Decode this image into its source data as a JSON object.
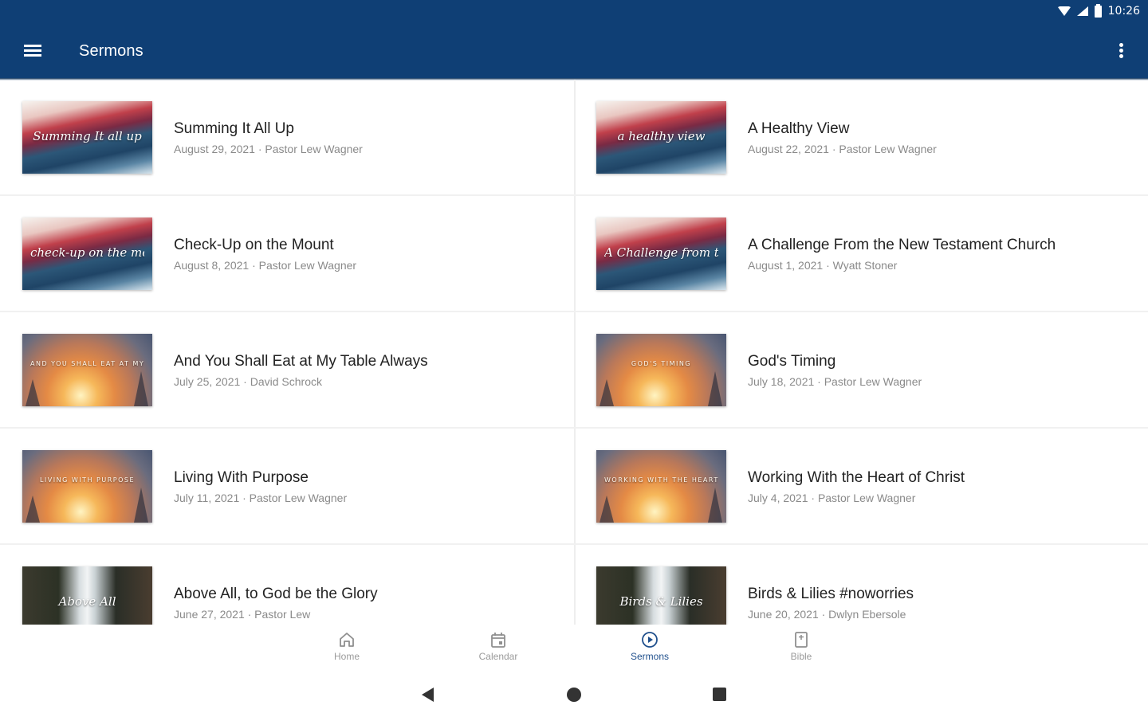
{
  "status_bar": {
    "time": "10:26"
  },
  "app_bar": {
    "title": "Sermons"
  },
  "sermons": [
    {
      "title": "Summing It All Up",
      "meta": "August 29, 2021 · Pastor Lew Wagner",
      "thumb_caption": "Summing It all up",
      "thumb_style": "wave"
    },
    {
      "title": "A Healthy View",
      "meta": "August 22, 2021 · Pastor Lew Wagner",
      "thumb_caption": "a healthy view",
      "thumb_style": "wave"
    },
    {
      "title": "Check-Up on the Mount",
      "meta": "August 8, 2021 · Pastor Lew Wagner",
      "thumb_caption": "check-up on the mount",
      "thumb_style": "wave"
    },
    {
      "title": "A Challenge From the New Testament Church",
      "meta": "August 1, 2021 · Wyatt Stoner",
      "thumb_caption": "A Challenge from the New Testament Church",
      "thumb_style": "wave"
    },
    {
      "title": "And You Shall Eat at My Table Always",
      "meta": "July 25, 2021 · David Schrock",
      "thumb_caption": "AND YOU SHALL EAT AT MY TABLE ALWAYS",
      "thumb_style": "sunrise"
    },
    {
      "title": "God's Timing",
      "meta": "July 18, 2021 · Pastor Lew Wagner",
      "thumb_caption": "GOD'S TIMING",
      "thumb_style": "sunrise"
    },
    {
      "title": "Living With Purpose",
      "meta": "July 11, 2021 · Pastor Lew Wagner",
      "thumb_caption": "LIVING WITH PURPOSE",
      "thumb_style": "sunrise"
    },
    {
      "title": "Working With the Heart of Christ",
      "meta": "July 4, 2021 · Pastor Lew Wagner",
      "thumb_caption": "WORKING WITH THE HEART OF CHRIST",
      "thumb_style": "sunrise"
    },
    {
      "title": "Above All, to God be the Glory",
      "meta": "June 27, 2021 · Pastor Lew",
      "thumb_caption": "Above All",
      "thumb_style": "falls"
    },
    {
      "title": "Birds & Lilies #noworries",
      "meta": "June 20, 2021 · Dwlyn Ebersole",
      "thumb_caption": "Birds & Lilies",
      "thumb_style": "falls"
    }
  ],
  "bottom_nav": [
    {
      "label": "Home",
      "icon": "home-icon",
      "active": false
    },
    {
      "label": "Calendar",
      "icon": "calendar-icon",
      "active": false
    },
    {
      "label": "Sermons",
      "icon": "play-circle-icon",
      "active": true
    },
    {
      "label": "Bible",
      "icon": "book-icon",
      "active": false
    }
  ],
  "colors": {
    "primary": "#0f3f75",
    "active_nav": "#1f4f8c",
    "meta_text": "#8a8a8a"
  }
}
